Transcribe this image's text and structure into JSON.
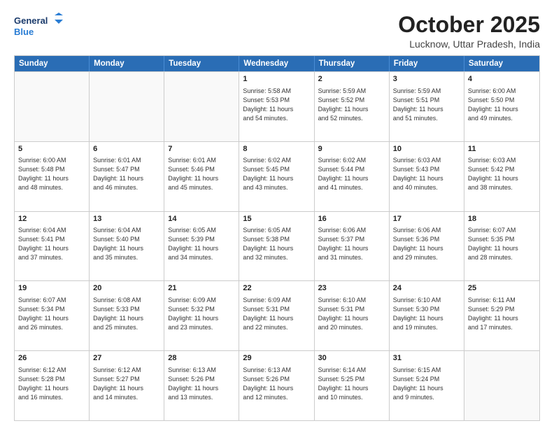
{
  "logo": {
    "line1": "General",
    "line2": "Blue"
  },
  "title": "October 2025",
  "location": "Lucknow, Uttar Pradesh, India",
  "days_header": [
    "Sunday",
    "Monday",
    "Tuesday",
    "Wednesday",
    "Thursday",
    "Friday",
    "Saturday"
  ],
  "weeks": [
    [
      {
        "day": "",
        "info": ""
      },
      {
        "day": "",
        "info": ""
      },
      {
        "day": "",
        "info": ""
      },
      {
        "day": "1",
        "info": "Sunrise: 5:58 AM\nSunset: 5:53 PM\nDaylight: 11 hours\nand 54 minutes."
      },
      {
        "day": "2",
        "info": "Sunrise: 5:59 AM\nSunset: 5:52 PM\nDaylight: 11 hours\nand 52 minutes."
      },
      {
        "day": "3",
        "info": "Sunrise: 5:59 AM\nSunset: 5:51 PM\nDaylight: 11 hours\nand 51 minutes."
      },
      {
        "day": "4",
        "info": "Sunrise: 6:00 AM\nSunset: 5:50 PM\nDaylight: 11 hours\nand 49 minutes."
      }
    ],
    [
      {
        "day": "5",
        "info": "Sunrise: 6:00 AM\nSunset: 5:48 PM\nDaylight: 11 hours\nand 48 minutes."
      },
      {
        "day": "6",
        "info": "Sunrise: 6:01 AM\nSunset: 5:47 PM\nDaylight: 11 hours\nand 46 minutes."
      },
      {
        "day": "7",
        "info": "Sunrise: 6:01 AM\nSunset: 5:46 PM\nDaylight: 11 hours\nand 45 minutes."
      },
      {
        "day": "8",
        "info": "Sunrise: 6:02 AM\nSunset: 5:45 PM\nDaylight: 11 hours\nand 43 minutes."
      },
      {
        "day": "9",
        "info": "Sunrise: 6:02 AM\nSunset: 5:44 PM\nDaylight: 11 hours\nand 41 minutes."
      },
      {
        "day": "10",
        "info": "Sunrise: 6:03 AM\nSunset: 5:43 PM\nDaylight: 11 hours\nand 40 minutes."
      },
      {
        "day": "11",
        "info": "Sunrise: 6:03 AM\nSunset: 5:42 PM\nDaylight: 11 hours\nand 38 minutes."
      }
    ],
    [
      {
        "day": "12",
        "info": "Sunrise: 6:04 AM\nSunset: 5:41 PM\nDaylight: 11 hours\nand 37 minutes."
      },
      {
        "day": "13",
        "info": "Sunrise: 6:04 AM\nSunset: 5:40 PM\nDaylight: 11 hours\nand 35 minutes."
      },
      {
        "day": "14",
        "info": "Sunrise: 6:05 AM\nSunset: 5:39 PM\nDaylight: 11 hours\nand 34 minutes."
      },
      {
        "day": "15",
        "info": "Sunrise: 6:05 AM\nSunset: 5:38 PM\nDaylight: 11 hours\nand 32 minutes."
      },
      {
        "day": "16",
        "info": "Sunrise: 6:06 AM\nSunset: 5:37 PM\nDaylight: 11 hours\nand 31 minutes."
      },
      {
        "day": "17",
        "info": "Sunrise: 6:06 AM\nSunset: 5:36 PM\nDaylight: 11 hours\nand 29 minutes."
      },
      {
        "day": "18",
        "info": "Sunrise: 6:07 AM\nSunset: 5:35 PM\nDaylight: 11 hours\nand 28 minutes."
      }
    ],
    [
      {
        "day": "19",
        "info": "Sunrise: 6:07 AM\nSunset: 5:34 PM\nDaylight: 11 hours\nand 26 minutes."
      },
      {
        "day": "20",
        "info": "Sunrise: 6:08 AM\nSunset: 5:33 PM\nDaylight: 11 hours\nand 25 minutes."
      },
      {
        "day": "21",
        "info": "Sunrise: 6:09 AM\nSunset: 5:32 PM\nDaylight: 11 hours\nand 23 minutes."
      },
      {
        "day": "22",
        "info": "Sunrise: 6:09 AM\nSunset: 5:31 PM\nDaylight: 11 hours\nand 22 minutes."
      },
      {
        "day": "23",
        "info": "Sunrise: 6:10 AM\nSunset: 5:31 PM\nDaylight: 11 hours\nand 20 minutes."
      },
      {
        "day": "24",
        "info": "Sunrise: 6:10 AM\nSunset: 5:30 PM\nDaylight: 11 hours\nand 19 minutes."
      },
      {
        "day": "25",
        "info": "Sunrise: 6:11 AM\nSunset: 5:29 PM\nDaylight: 11 hours\nand 17 minutes."
      }
    ],
    [
      {
        "day": "26",
        "info": "Sunrise: 6:12 AM\nSunset: 5:28 PM\nDaylight: 11 hours\nand 16 minutes."
      },
      {
        "day": "27",
        "info": "Sunrise: 6:12 AM\nSunset: 5:27 PM\nDaylight: 11 hours\nand 14 minutes."
      },
      {
        "day": "28",
        "info": "Sunrise: 6:13 AM\nSunset: 5:26 PM\nDaylight: 11 hours\nand 13 minutes."
      },
      {
        "day": "29",
        "info": "Sunrise: 6:13 AM\nSunset: 5:26 PM\nDaylight: 11 hours\nand 12 minutes."
      },
      {
        "day": "30",
        "info": "Sunrise: 6:14 AM\nSunset: 5:25 PM\nDaylight: 11 hours\nand 10 minutes."
      },
      {
        "day": "31",
        "info": "Sunrise: 6:15 AM\nSunset: 5:24 PM\nDaylight: 11 hours\nand 9 minutes."
      },
      {
        "day": "",
        "info": ""
      }
    ]
  ]
}
